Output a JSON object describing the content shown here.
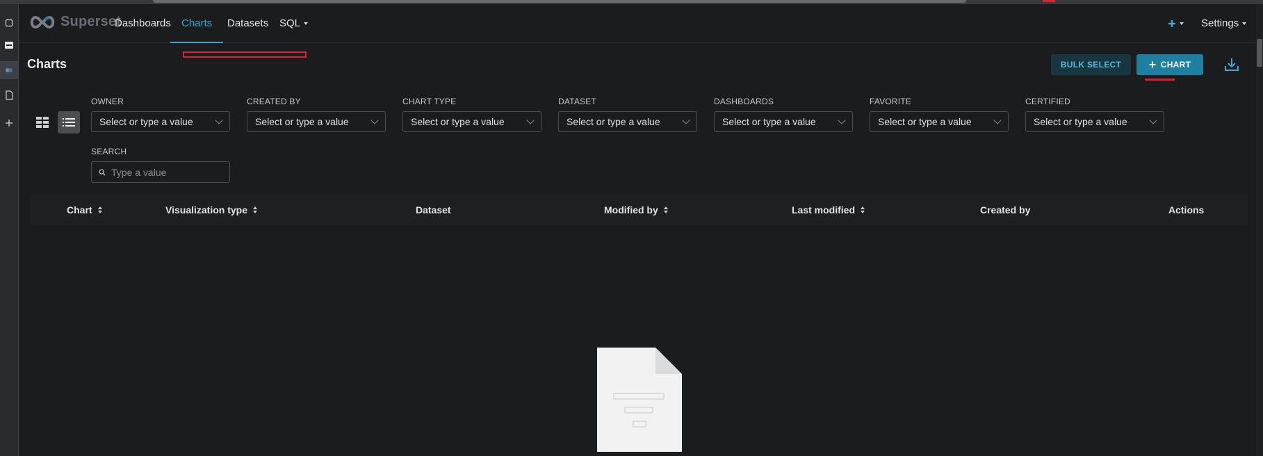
{
  "app": {
    "name": "Superset"
  },
  "nav": {
    "items": [
      {
        "label": "Dashboards",
        "active": false
      },
      {
        "label": "Charts",
        "active": true
      },
      {
        "label": "Datasets",
        "active": false
      },
      {
        "label": "SQL",
        "active": false,
        "dropdown": true
      }
    ],
    "right": {
      "add_icon": "plus-icon",
      "settings_label": "Settings"
    }
  },
  "header": {
    "title": "Charts",
    "bulk_select_label": "BULK SELECT",
    "add_chart_label": "CHART",
    "download_icon": "download-icon"
  },
  "filters": {
    "items": [
      {
        "label": "OWNER",
        "placeholder": "Select or type a value"
      },
      {
        "label": "CREATED BY",
        "placeholder": "Select or type a value"
      },
      {
        "label": "CHART TYPE",
        "placeholder": "Select or type a value"
      },
      {
        "label": "DATASET",
        "placeholder": "Select or type a value"
      },
      {
        "label": "DASHBOARDS",
        "placeholder": "Select or type a value"
      },
      {
        "label": "FAVORITE",
        "placeholder": "Select or type a value"
      },
      {
        "label": "CERTIFIED",
        "placeholder": "Select or type a value"
      }
    ],
    "search": {
      "label": "SEARCH",
      "placeholder": "Type a value"
    }
  },
  "table": {
    "columns": [
      {
        "label": "Chart",
        "sortable": true
      },
      {
        "label": "Visualization type",
        "sortable": true
      },
      {
        "label": "Dataset",
        "sortable": false
      },
      {
        "label": "Modified by",
        "sortable": true
      },
      {
        "label": "Last modified",
        "sortable": true
      },
      {
        "label": "Created by",
        "sortable": false
      },
      {
        "label": "Actions",
        "sortable": false
      }
    ],
    "rows": []
  },
  "colors": {
    "background": "#1b1c1e",
    "accent": "#3fa7d0",
    "primary_button": "#1f7fa0",
    "secondary_button": "#173640",
    "annotation_red": "#d9232e"
  }
}
